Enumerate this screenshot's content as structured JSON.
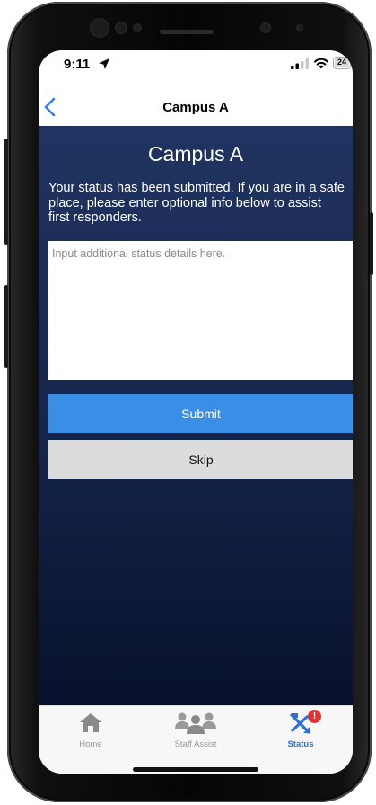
{
  "status_bar": {
    "time": "9:11",
    "location_icon": "location-arrow-icon",
    "signal_icon": "cellular-signal-icon",
    "wifi_icon": "wifi-icon",
    "battery_level": "24"
  },
  "header": {
    "back_icon": "chevron-left-icon",
    "title": "Campus A"
  },
  "main": {
    "title": "Campus A",
    "message": "Your status has been submitted. If you are in a safe place, please enter optional info below to assist first responders.",
    "details_input": {
      "value": "",
      "placeholder": "Input additional status details here."
    },
    "submit_label": "Submit",
    "skip_label": "Skip"
  },
  "tabbar": {
    "tabs": [
      {
        "label": "Home",
        "icon": "house-icon",
        "active": false
      },
      {
        "label": "Staff Assist",
        "icon": "people-group-icon",
        "active": false
      },
      {
        "label": "Status",
        "icon": "status-icon",
        "active": true,
        "badge": "!"
      }
    ]
  },
  "colors": {
    "accent": "#3a8ee6",
    "active_tab": "#2f6fd8",
    "background_top": "#213461",
    "background_bottom": "#07112b",
    "badge": "#e63030"
  }
}
